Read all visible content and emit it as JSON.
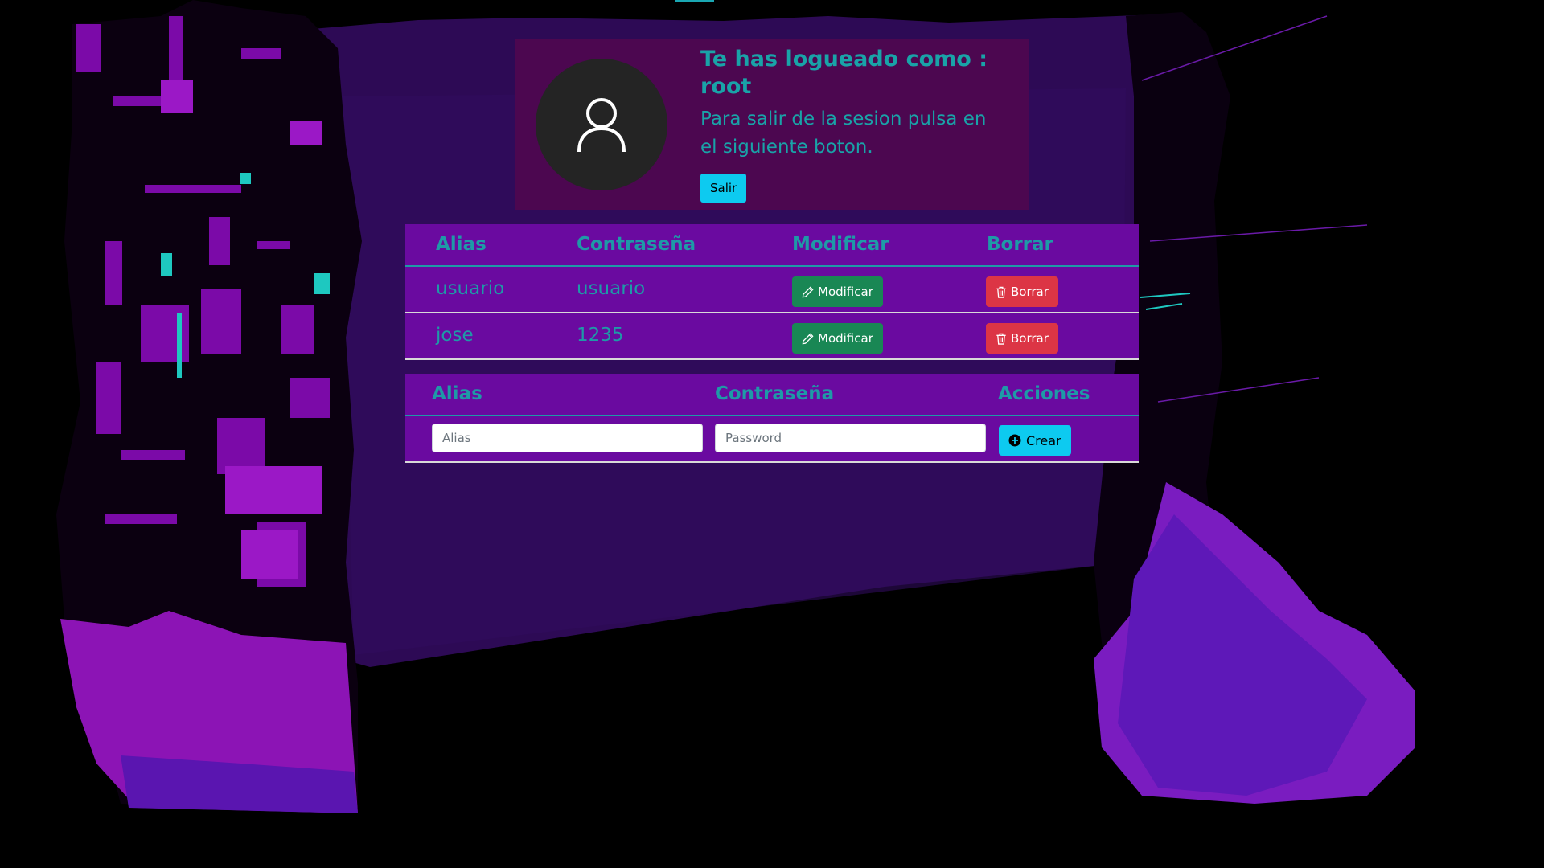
{
  "profile": {
    "title": "Te has logueado como : root",
    "text": "Para salir de la sesion pulsa en el siguiente boton.",
    "logout_label": "Salir",
    "avatar_icon": "user-icon"
  },
  "users_table": {
    "headers": [
      "Alias",
      "Contraseña",
      "Modificar",
      "Borrar"
    ],
    "rows": [
      {
        "alias": "usuario",
        "password": "usuario",
        "modify_label": "Modificar",
        "delete_label": "Borrar"
      },
      {
        "alias": "jose",
        "password": "1235",
        "modify_label": "Modificar",
        "delete_label": "Borrar"
      }
    ]
  },
  "create_table": {
    "headers": [
      "Alias",
      "Contraseña",
      "Acciones"
    ],
    "alias_placeholder": "Alias",
    "password_placeholder": "Password",
    "create_label": "Crear"
  },
  "colors": {
    "background": "#000000",
    "panel": "#2d0a55",
    "card": "#4c0750",
    "table": "#6a0aa0",
    "text_accent": "#1e9aa7",
    "btn_info": "#0dcaf0",
    "btn_success": "#198754",
    "btn_danger": "#dc3545"
  },
  "icons": [
    "user-icon",
    "pencil-icon",
    "trash-icon",
    "plus-circle-icon"
  ]
}
